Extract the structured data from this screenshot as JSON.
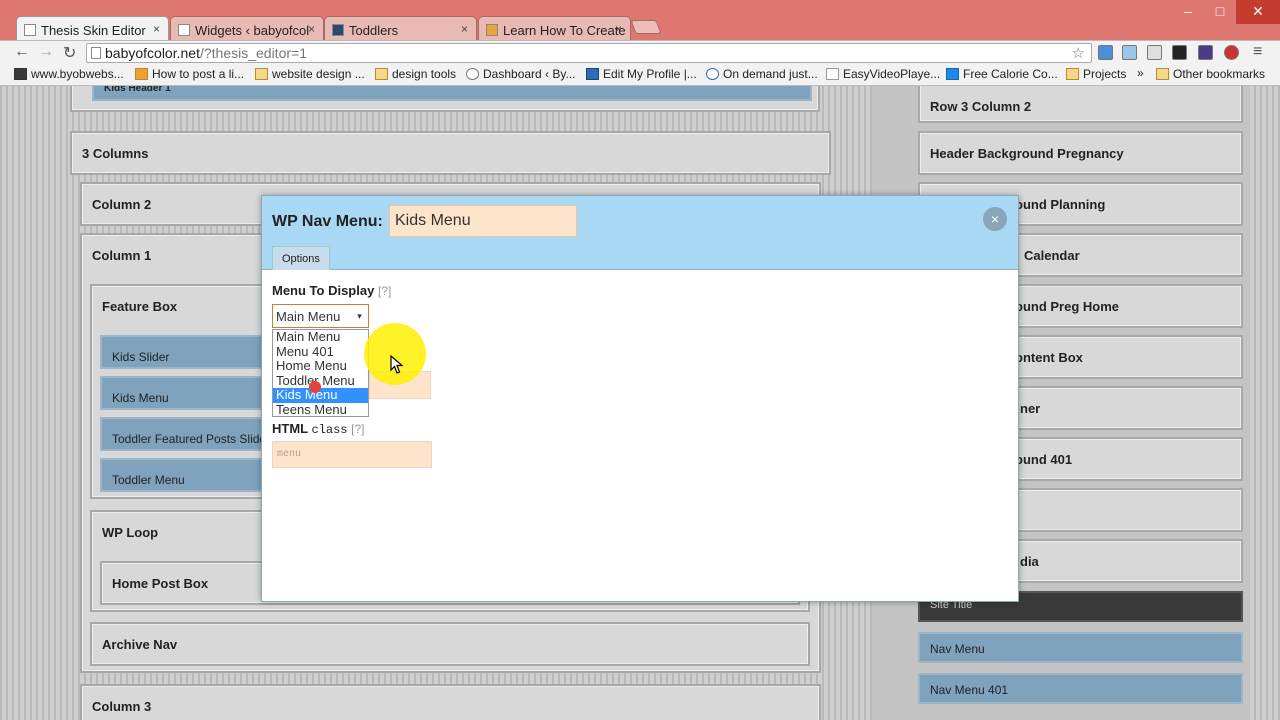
{
  "browser": {
    "tabs": [
      {
        "title": "Thesis Skin Editor",
        "active": true
      },
      {
        "title": "Widgets ‹ babyofcol",
        "active": false
      },
      {
        "title": "Toddlers",
        "active": false
      },
      {
        "title": "Learn How To Create",
        "active": false
      }
    ],
    "close_glyph": "×",
    "url_host": "babyofcolor.net",
    "url_path": "/?thesis_editor=1",
    "bookmarks": [
      "www.byobwebs...",
      "How to post a li...",
      "website design ...",
      "design tools",
      "Dashboard ‹ By...",
      "Edit My Profile |...",
      "On demand just...",
      "EasyVideoPlaye...",
      "Free Calorie Co...",
      "Projects",
      "»",
      "Other bookmarks"
    ]
  },
  "left_panel": {
    "kids_header": "Kids Header 1",
    "three_columns": "3 Columns",
    "column2": "Column 2",
    "column1": "Column 1",
    "feature_box": "Feature Box",
    "kids_slider": "Kids Slider",
    "kids_menu": "Kids Menu",
    "toddler_featured": "Toddler Featured Posts Slider",
    "toddler_menu": "Toddler Menu",
    "wp_loop": "WP Loop",
    "home_post_box": "Home Post Box",
    "archive_nav": "Archive Nav",
    "column3": "Column 3"
  },
  "right_panel": {
    "items": [
      "Row 3 Column 2",
      "Header Background Pregnancy",
      "ound Planning",
      "Calendar",
      "ound Preg Home",
      "ontent Box",
      "ner",
      "ound 401",
      "",
      "dia"
    ],
    "site_title": "Site Title",
    "nav_menu": "Nav Menu",
    "nav_menu_401": "Nav Menu 401"
  },
  "modal": {
    "title": "WP Nav Menu:",
    "name_value": "Kids Menu",
    "close_glyph": "×",
    "tab_options": "Options",
    "menu_label": "Menu To Display",
    "help": "[?]",
    "select_value": "Main Menu",
    "select_arrow": "▾",
    "options": [
      "Main Menu",
      "Menu 401",
      "Home Menu",
      "Toddler Menu",
      "Kids Menu",
      "Teens Menu"
    ],
    "selected_option": "Kids Menu",
    "html_label": "HTML",
    "html_code": "class",
    "class_placeholder": "menu"
  }
}
